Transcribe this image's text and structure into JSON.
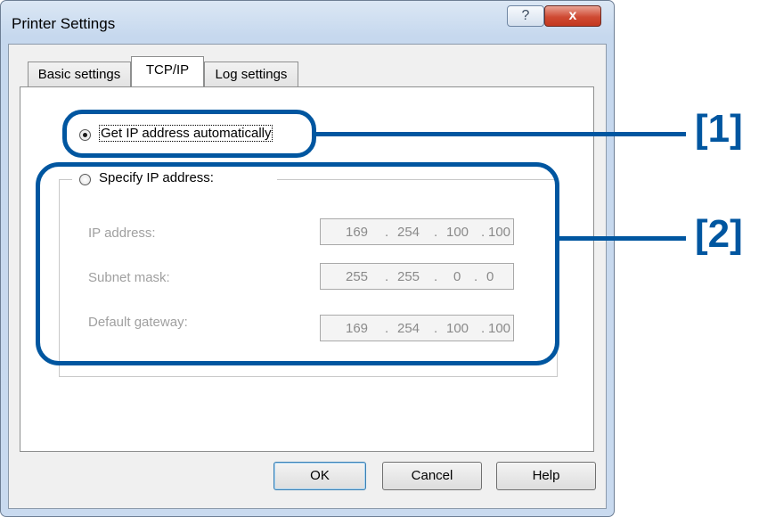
{
  "window": {
    "title": "Printer Settings",
    "help_button": "?",
    "close_button": "x"
  },
  "tabs": [
    {
      "label": "Basic settings",
      "active": false
    },
    {
      "label": "TCP/IP",
      "active": true
    },
    {
      "label": "Log settings",
      "active": false
    }
  ],
  "ip_mode": {
    "auto_label": "Get IP address automatically",
    "auto_selected": true,
    "specify_label": "Specify IP address:",
    "specify_selected": false
  },
  "fields": [
    {
      "label": "IP address:",
      "octets": [
        "169",
        "254",
        "100",
        "100"
      ],
      "enabled": false
    },
    {
      "label": "Subnet mask:",
      "octets": [
        "255",
        "255",
        "0",
        "0"
      ],
      "enabled": false
    },
    {
      "label": "Default gateway:",
      "octets": [
        "169",
        "254",
        "100",
        "100"
      ],
      "enabled": false
    }
  ],
  "buttons": {
    "ok": "OK",
    "cancel": "Cancel",
    "help": "Help"
  },
  "annotations": [
    {
      "label": "[1]"
    },
    {
      "label": "[2]"
    }
  ],
  "colors": {
    "annotation": "#0056a0"
  }
}
